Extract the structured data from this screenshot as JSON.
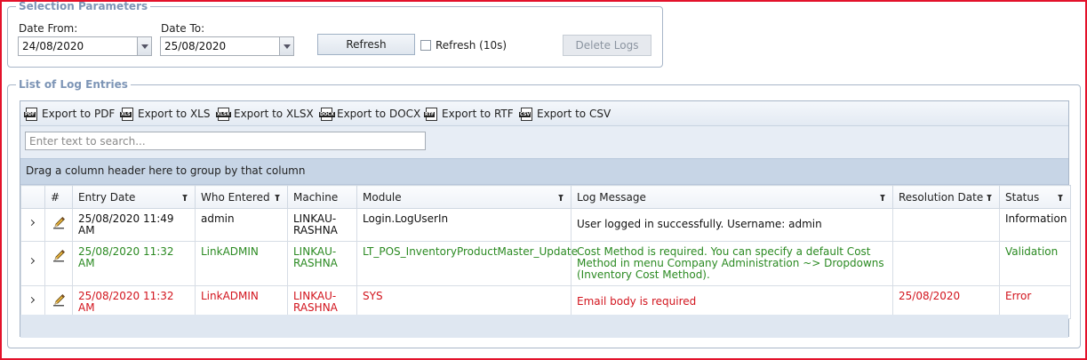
{
  "selection": {
    "legend": "Selection Parameters",
    "date_from_label": "Date From:",
    "date_from_value": "24/08/2020",
    "date_to_label": "Date To:",
    "date_to_value": "25/08/2020",
    "refresh_button": "Refresh",
    "auto_refresh_label": "Refresh (10s)",
    "auto_refresh_checked": false,
    "delete_button": "Delete Logs"
  },
  "log": {
    "legend": "List of Log Entries",
    "exports": [
      {
        "label": "Export to PDF",
        "icon": "pdf-file-icon",
        "tag": "PDF"
      },
      {
        "label": "Export to XLS",
        "icon": "xls-file-icon",
        "tag": "XLS"
      },
      {
        "label": "Export to XLSX",
        "icon": "xlsx-file-icon",
        "tag": "XLSX"
      },
      {
        "label": "Export to DOCX",
        "icon": "docx-file-icon",
        "tag": "DOCX"
      },
      {
        "label": "Export to RTF",
        "icon": "rtf-file-icon",
        "tag": "RTF"
      },
      {
        "label": "Export to CSV",
        "icon": "csv-file-icon",
        "tag": "CSV"
      }
    ],
    "search_placeholder": "Enter text to search...",
    "group_hint": "Drag a column header here to group by that column",
    "columns": {
      "num": "#",
      "entry_date": "Entry Date",
      "who": "Who Entered",
      "machine": "Machine",
      "module": "Module",
      "message": "Log Message",
      "resolution": "Resolution Date",
      "status": "Status"
    },
    "rows": [
      {
        "entry_date": "25/08/2020 11:49 AM",
        "who": "admin",
        "machine": "LINKAU-RASHNA",
        "module": "Login.LogUserIn",
        "message": "User logged in successfully. Username: admin",
        "resolution": "",
        "status": "Information"
      },
      {
        "entry_date": "25/08/2020 11:32 AM",
        "who": "LinkADMIN",
        "machine": "LINKAU-RASHNA",
        "module": "LT_POS_InventoryProductMaster_Update",
        "message": "Cost Method is required. You can specify a default Cost Method in menu Company Administration ~> Dropdowns (Inventory Cost Method).",
        "resolution": "",
        "status": "Validation"
      },
      {
        "entry_date": "25/08/2020 11:32 AM",
        "who": "LinkADMIN",
        "machine": "LINKAU-RASHNA",
        "module": "SYS",
        "message": "Email body is required",
        "resolution": "25/08/2020",
        "status": "Error"
      }
    ]
  },
  "colors": {
    "frame_border": "#e3122b",
    "legend_text": "#7d95b6",
    "validation_text": "#2b8a22",
    "error_text": "#d2141d"
  }
}
